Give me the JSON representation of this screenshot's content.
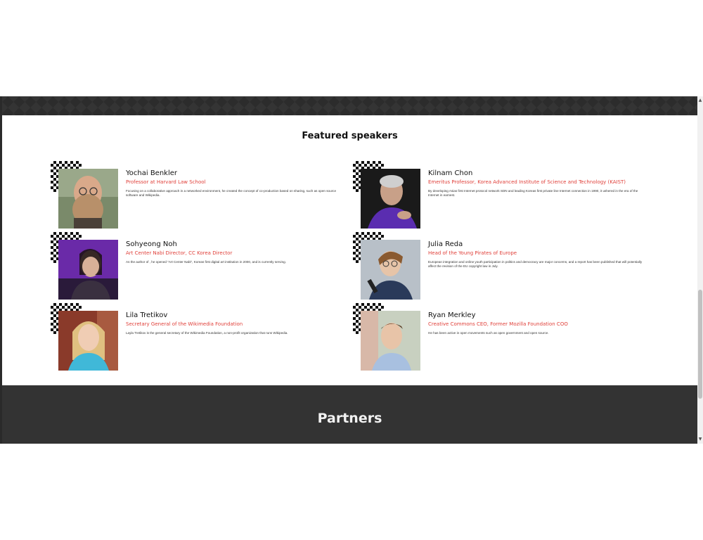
{
  "section_title": "Featured speakers",
  "speakers": [
    {
      "name": "Yochai Benkler",
      "role": "Professor at Harvard Law School",
      "bio": "Focusing on a collaborative approach in a networked environment, he created the concept of co-production based on sharing, such as open source software and Wikipedia."
    },
    {
      "name": "Kilnam Chon",
      "role": "Emeritus Professor, Korea Advanced Institute of Science and Technology (KAIST)",
      "bio": "By developing Asias first Internet protocol network SDN and leading Koreas first private line Internet connection in 1990, it ushered in the era of the Internet in earnest."
    },
    {
      "name": "Sohyeong Noh",
      "role": "Art Center Nabi Director, CC Korea Director",
      "bio": "As the author of , he opened \"Art Center Nabi\", Koreas first digital art institution in 2000, and is currently serving."
    },
    {
      "name": "Julia Reda",
      "role": "Head of the Young Pirates of Europe",
      "bio": "European integration and online youth participation in politics and democracy are major concerns, and a report has been published that will potentially affect the revision of the EU copyright law in July."
    },
    {
      "name": "Lila Tretikov",
      "role": "Secretary General of the Wikimedia Foundation",
      "bio": "Layla Tretikov is the general secretary of the Wikimedia Foundation, a non-profit organization that runs Wikipedia."
    },
    {
      "name": "Ryan Merkley",
      "role": "Creative Commons CEO, Former Mozilla Foundation COO",
      "bio": "He has been active in open movements such as open government and open source."
    }
  ],
  "partners_title": "Partners",
  "colors": {
    "accent": "#e0403a",
    "dark_band": "#333333",
    "text": "#111111"
  },
  "icons": {
    "scroll_up": "▲",
    "scroll_down": "▼"
  }
}
